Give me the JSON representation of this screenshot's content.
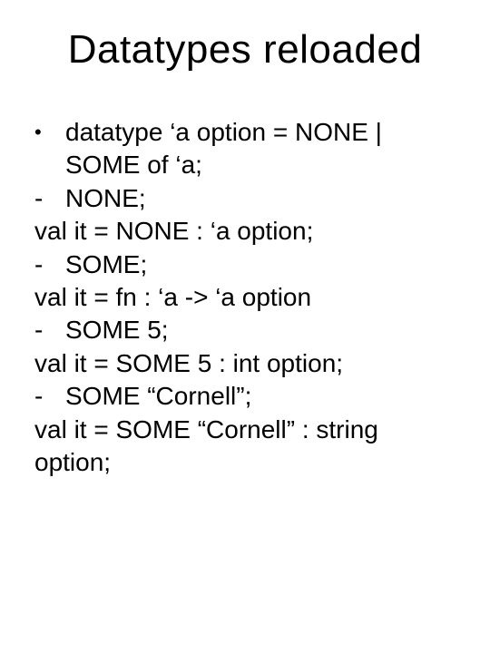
{
  "title": "Datatypes reloaded",
  "lines": {
    "l1": "datatype ‘a option = NONE | SOME of ‘a;",
    "l2": "NONE;",
    "l3": "val it = NONE : ‘a option;",
    "l4": "SOME;",
    "l5": "val it = fn : ‘a -> ‘a option",
    "l6": "SOME 5;",
    "l7": "val it = SOME 5 : int option;",
    "l8": "SOME “Cornell”;",
    "l9": "val it = SOME “Cornell” : string option;"
  }
}
